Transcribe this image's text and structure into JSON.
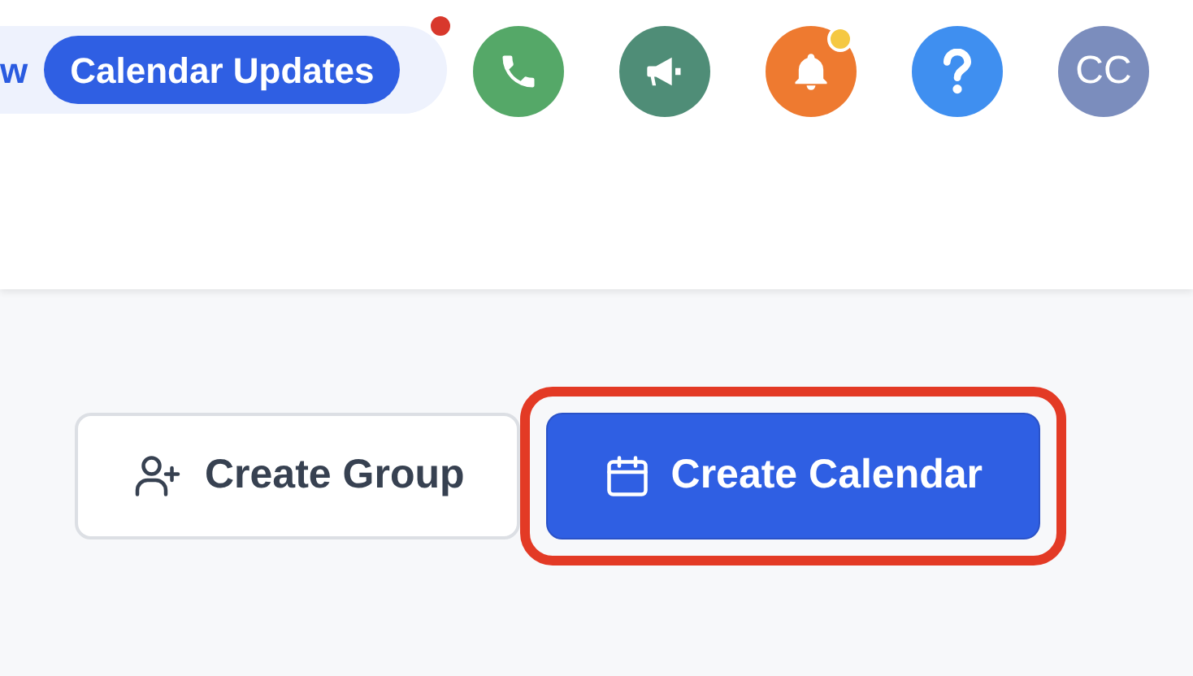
{
  "announcement": {
    "text": "w",
    "badge": "Calendar Updates",
    "unread": true
  },
  "header_icons": [
    {
      "kind": "phone",
      "color": "#55a868",
      "dot": false
    },
    {
      "kind": "megaphone",
      "color": "#4f8d77",
      "dot": false
    },
    {
      "kind": "bell",
      "color": "#ee7a30",
      "dot": true
    },
    {
      "kind": "help",
      "color": "#3f8ff0",
      "dot": false
    },
    {
      "kind": "avatar",
      "color": "#7b8dbd",
      "dot": false,
      "initials": "CC"
    }
  ],
  "actions": [
    {
      "kind": "group",
      "label": "Create Group",
      "primary": false,
      "highlighted": false
    },
    {
      "kind": "calendar",
      "label": "Create Calendar",
      "primary": true,
      "highlighted": true
    }
  ]
}
